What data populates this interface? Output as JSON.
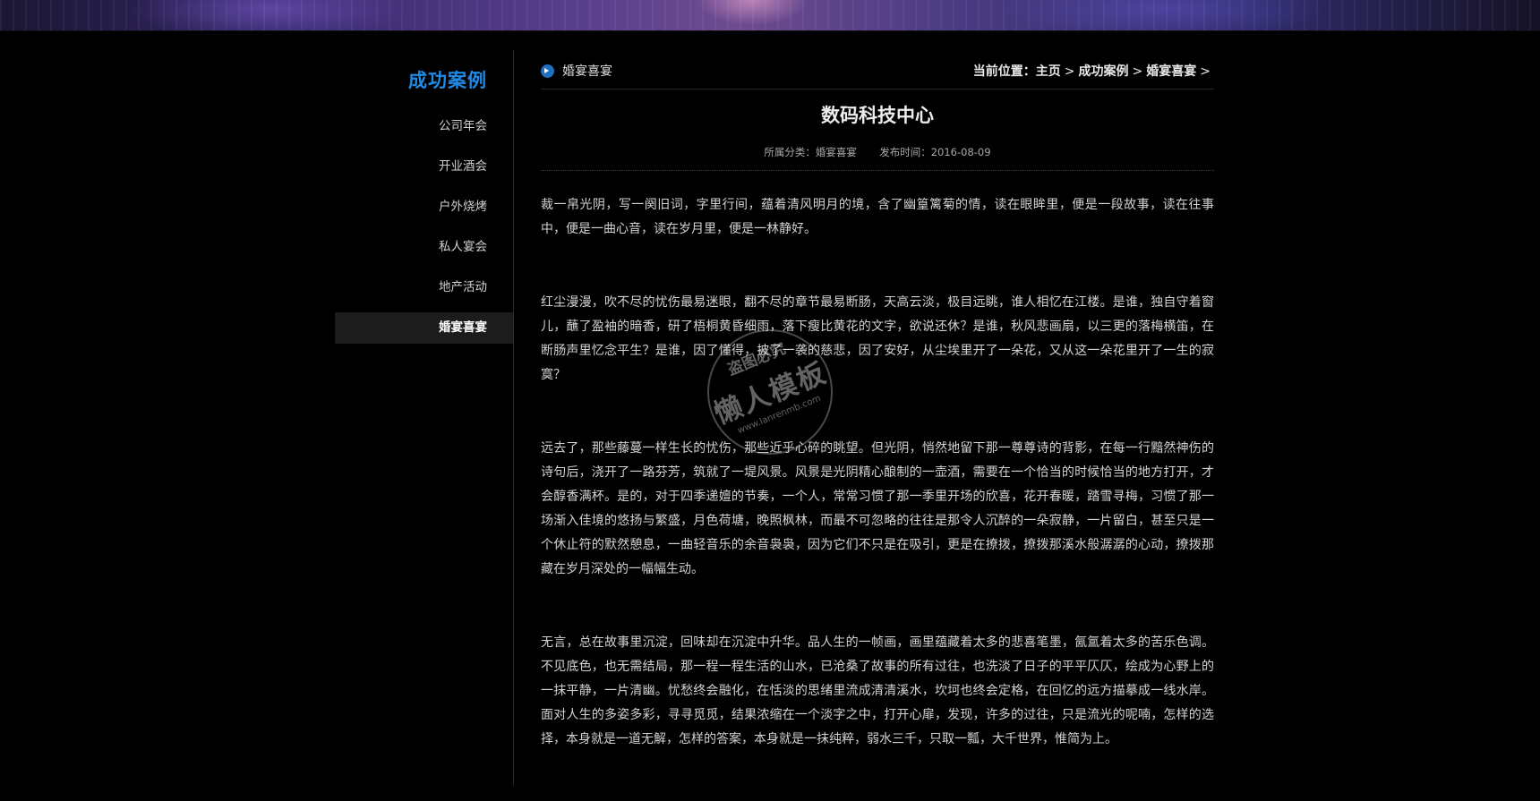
{
  "sidebar": {
    "title": "成功案例",
    "items": [
      {
        "label": "公司年会",
        "active": false
      },
      {
        "label": "开业酒会",
        "active": false
      },
      {
        "label": "户外烧烤",
        "active": false
      },
      {
        "label": "私人宴会",
        "active": false
      },
      {
        "label": "地产活动",
        "active": false
      },
      {
        "label": "婚宴喜宴",
        "active": true
      }
    ]
  },
  "header": {
    "category": "婚宴喜宴",
    "breadcrumb": {
      "prefix": "当前位置：",
      "items": [
        "主页",
        "成功案例",
        "婚宴喜宴"
      ],
      "separator": ">"
    }
  },
  "article": {
    "title": "数码科技中心",
    "category_label": "所属分类：婚宴喜宴",
    "date_label": "发布时间：2016-08-09",
    "paragraphs": [
      "裁一帛光阴，写一阕旧词，字里行间，蕴着清风明月的境，含了幽篁篱菊的情，读在眼眸里，便是一段故事，读在往事中，便是一曲心音，读在岁月里，便是一林静好。",
      "红尘漫漫，吹不尽的忧伤最易迷眼，翻不尽的章节最易断肠，天高云淡，极目远眺，谁人相忆在江楼。是谁，独自守着窗儿，蘸了盈袖的暗香，研了梧桐黄昏细雨，落下瘦比黄花的文字，欲说还休？是谁，秋风悲画扇，以三更的落梅横笛，在断肠声里忆念平生？是谁，因了懂得，披了一袭的慈悲，因了安好，从尘埃里开了一朵花，又从这一朵花里开了一生的寂寞？",
      "远去了，那些藤蔓一样生长的忧伤，那些近乎心碎的眺望。但光阴，悄然地留下那一尊尊诗的背影，在每一行黯然神伤的诗句后，浇开了一路芬芳，筑就了一堤风景。风景是光阴精心酿制的一壶酒，需要在一个恰当的时候恰当的地方打开，才会醇香满杯。是的，对于四季递嬗的节奏，一个人，常常习惯了那一季里开场的欣喜，花开春暖，踏雪寻梅，习惯了那一场渐入佳境的悠扬与繁盛，月色荷塘，晚照枫林，而最不可忽略的往往是那令人沉醉的一朵寂静，一片留白，甚至只是一个休止符的默然憩息，一曲轻音乐的余音袅袅，因为它们不只是在吸引，更是在撩拨，撩拨那溪水般潺潺的心动，撩拨那藏在岁月深处的一幅幅生动。",
      "无言，总在故事里沉淀，回味却在沉淀中升华。品人生的一帧画，画里蕴藏着太多的悲喜笔墨，氤氲着太多的苦乐色调。不见底色，也无需结局，那一程一程生活的山水，已沧桑了故事的所有过往，也洗淡了日子的平平仄仄，绘成为心野上的一抹平静，一片清幽。忧愁终会融化，在恬淡的思绪里流成清清溪水，坎坷也终会定格，在回忆的远方描摹成一线水岸。面对人生的多姿多彩，寻寻觅觅，结果浓缩在一个淡字之中，打开心扉，发现，许多的过往，只是流光的呢喃，怎样的选择，本身就是一道无解，怎样的答案，本身就是一抹纯粹，弱水三千，只取一瓢，大千世界，惟简为上。"
    ]
  },
  "watermark": {
    "top": "盗图必究",
    "middle": "懒人模板",
    "url": "www.lanrenmb.com"
  },
  "colors": {
    "accent": "#1f8ae8",
    "background": "#000000",
    "active_item_bg": "#1c1c1c"
  }
}
